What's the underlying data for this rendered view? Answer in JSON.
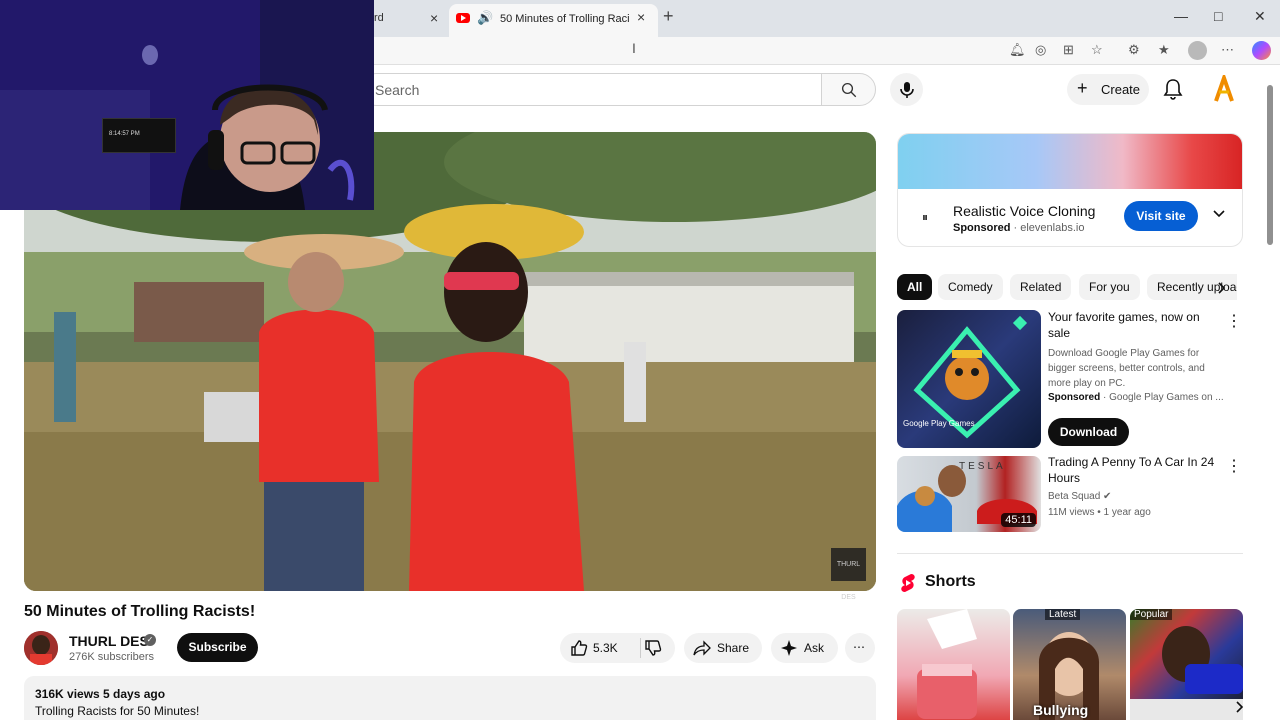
{
  "browser": {
    "prev_tab_title": "rd",
    "active_tab_title": "50 Minutes of Trolling Racists!",
    "close_symbol": "×",
    "new_tab_symbol": "+",
    "window_minimize": "—",
    "window_maximize": "□",
    "window_close": "✕"
  },
  "webcam": {
    "clock_text": "8:14:57 PM"
  },
  "header": {
    "search_placeholder": "Search",
    "create_label": "Create"
  },
  "video": {
    "title": "50 Minutes of Trolling Racists!",
    "watermark": "THURL DES",
    "channel_name": "THURL DES",
    "subscribers": "276K subscribers",
    "subscribe_label": "Subscribe",
    "like_count": "5.3K",
    "share_label": "Share",
    "ask_label": "Ask",
    "stats": "316K views  5 days ago",
    "description": "Trolling Racists for 50 Minutes!"
  },
  "ad": {
    "title": "Realistic Voice Cloning",
    "sponsored": "Sponsored",
    "domain": "elevenlabs.io",
    "visit_label": "Visit site",
    "colors": {
      "accent": "#065fd4"
    }
  },
  "chips": [
    {
      "label": "All",
      "active": true
    },
    {
      "label": "Comedy",
      "active": false
    },
    {
      "label": "Related",
      "active": false
    },
    {
      "label": "For you",
      "active": false
    },
    {
      "label": "Recently uploaded",
      "active": false
    }
  ],
  "recommendations": [
    {
      "title": "Your favorite games, now on sale",
      "meta_line": "Download Google Play Games for bigger screens, better controls, and more play on PC.",
      "sponsored": "Sponsored",
      "channel": "Google Play Games on ...",
      "thumb_text": "Google Play Games",
      "button_label": "Download"
    },
    {
      "title": "Trading A Penny To A Car In 24 Hours",
      "channel": "Beta Squad",
      "meta": "11M views • 1 year ago",
      "duration": "45:11",
      "thumb_text": "TESLA"
    }
  ],
  "shorts": {
    "label": "Shorts",
    "items": [
      {
        "tag": "",
        "caption": ""
      },
      {
        "tag": "Latest",
        "caption": "Bullying"
      },
      {
        "tag": "Popular",
        "caption": ""
      }
    ]
  }
}
